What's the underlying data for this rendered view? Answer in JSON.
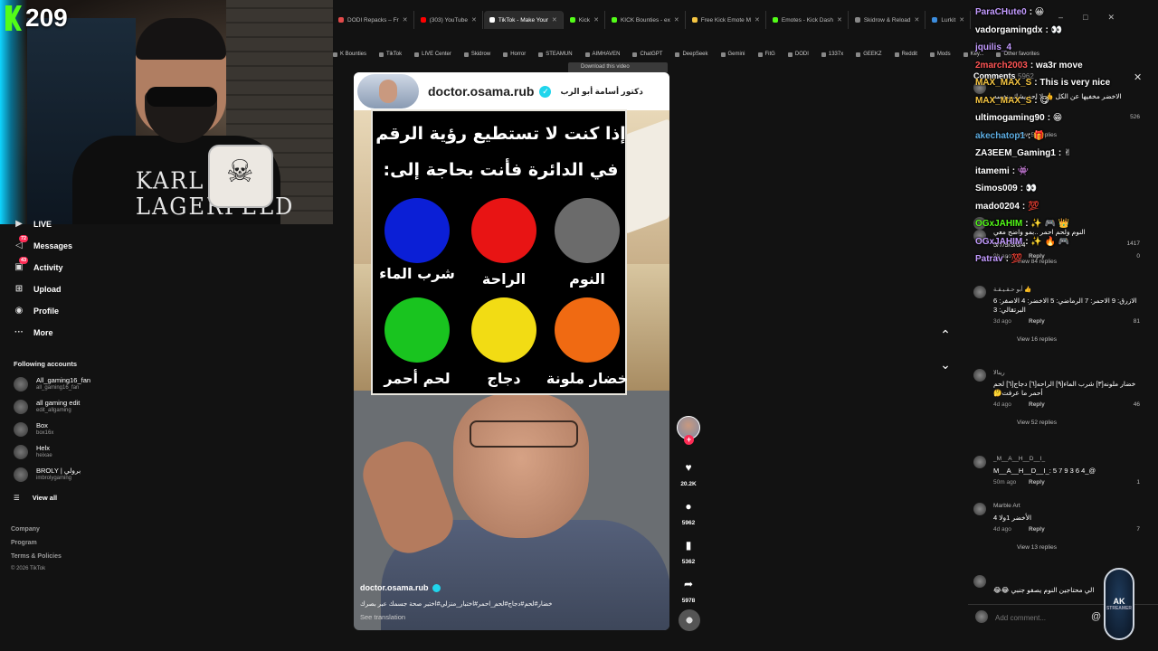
{
  "stream": {
    "viewer_count": "209",
    "cam_text": "KARL\nLAGERFELD"
  },
  "tabs": [
    {
      "label": "DODI Repacks – Fr",
      "color": "#e24a4a",
      "active": false
    },
    {
      "label": "(303) YouTube",
      "color": "#ff0000",
      "active": false
    },
    {
      "label": "TikTok - Make Your",
      "color": "#ffffff",
      "active": true
    },
    {
      "label": "Kick",
      "color": "#53fc18",
      "active": false
    },
    {
      "label": "KICK Bounties - ex",
      "color": "#53fc18",
      "active": false
    },
    {
      "label": "Free Kick Emote M",
      "color": "#f5c542",
      "active": false
    },
    {
      "label": "Emotes - Kick Dash",
      "color": "#53fc18",
      "active": false
    },
    {
      "label": "Skidrow & Reload",
      "color": "#888888",
      "active": false
    },
    {
      "label": "Lurkit",
      "color": "#3c8dde",
      "active": false
    }
  ],
  "window_controls": [
    "–",
    "□",
    "✕"
  ],
  "bookmarks": [
    "K Bounties",
    "TikTok",
    "LIVE Center",
    "Skidrow",
    "Horror",
    "STEAMUN",
    "AIMHAVEN",
    "ChatGPT",
    "DeepSeek",
    "Gemini",
    "FitG",
    "DODI",
    "1337x",
    "GEEKZ",
    "Reddit",
    "Mods",
    "Key...",
    "Other favorites"
  ],
  "download_tip": "Download this video",
  "sidebar": {
    "nav": [
      {
        "label": "LIVE",
        "icon": "live-icon",
        "glyph": "▶",
        "badge": ""
      },
      {
        "label": "Messages",
        "icon": "messages-icon",
        "glyph": "◁",
        "badge": "72"
      },
      {
        "label": "Activity",
        "icon": "activity-icon",
        "glyph": "▣",
        "badge": "43"
      },
      {
        "label": "Upload",
        "icon": "upload-icon",
        "glyph": "⊞",
        "badge": ""
      },
      {
        "label": "Profile",
        "icon": "profile-icon",
        "glyph": "◉",
        "badge": ""
      },
      {
        "label": "More",
        "icon": "more-icon",
        "glyph": "···",
        "badge": ""
      }
    ],
    "following_title": "Following accounts",
    "accounts": [
      {
        "name": "All_gaming16_fan",
        "handle": "all_gaming16_fan"
      },
      {
        "name": "all gaming edit",
        "handle": "edit_allgaming"
      },
      {
        "name": "Box",
        "handle": "box16x"
      },
      {
        "name": "Helx",
        "handle": "heixae"
      },
      {
        "name": "BROLY | برولي",
        "handle": "imbrolygaming"
      }
    ],
    "view_all": "View all",
    "footer": [
      "Company",
      "Program",
      "Terms & Policies"
    ],
    "copyright": "© 2026 TikTok"
  },
  "video": {
    "username": "doctor.osama.rub",
    "display_name_ar": "دكتور أسامة أبو الرب",
    "card_line1": "إذا كنت لا تستطيع رؤية الرقم",
    "card_line2": "في الدائرة فأنت بحاجة إلى:",
    "circles": [
      {
        "label": "شرب الماء",
        "color": "#0b1fd6"
      },
      {
        "label": "الراحة",
        "color": "#e81414"
      },
      {
        "label": "النوم",
        "color": "#6b6b6b"
      },
      {
        "label": "لحم أحمر",
        "color": "#19c41f"
      },
      {
        "label": "دجاج",
        "color": "#f2dc14"
      },
      {
        "label": "خضار ملونة",
        "color": "#f06a12"
      }
    ],
    "caption_user": "doctor.osama.rub",
    "caption_tags": "خضار#لحم#دجاج#لحم_احمر#اختبار_منزلي#اختبر صحة جسمك عبر بصرك",
    "see_translation": "See translation"
  },
  "actions": {
    "likes": "20.2K",
    "comments": "5962",
    "saves": "5362",
    "shares": "5978"
  },
  "comments": {
    "title": "Comments",
    "count": "5962",
    "items": [
      {
        "user": "",
        "text": "الاخضر مخفيها عن الكل 👍 لا احد يشك بنفسه",
        "date": "",
        "likes": "526",
        "replies": "View 54 replies"
      },
      {
        "user": "",
        "text": "النوم ولحم احمر ..بمو واضح معي",
        "date": "",
        "likes": "1417",
        "replies": "View 84 replies"
      },
      {
        "user": "",
        "text": "5/7/9/3/6/4",
        "date": "9h ago",
        "likes": "0",
        "replies": ""
      },
      {
        "user": "أبو حـقـيـقـة 👍",
        "text": "الازرق: 9 الاحمر: 7 الرماضي: 5 الاخضر: 4 الاصفر: 6 البرتقالي: 3",
        "date": "3d ago",
        "likes": "81",
        "replies": "View 16 replies"
      },
      {
        "user": "ريتالا",
        "text": "خضار ملونه[٣] شرب الماء[٩] الراحه[٦] دجاج[٦] لحم أحمر ما عرفت🤔",
        "date": "4d ago",
        "likes": "46",
        "replies": "View 52 replies"
      },
      {
        "user": "_M__A__H__D__I_",
        "text": "@_M__A__H__D__I_: 5 7 9 3 6 4",
        "date": "50m ago",
        "likes": "1",
        "replies": ""
      },
      {
        "user": "Marble Art",
        "text": "الأخضر 1ولا 4",
        "date": "4d ago",
        "likes": "7",
        "replies": "View 13 replies"
      },
      {
        "user": "",
        "text": "الي محتاجين النوم يصفو جنبي 😂😂",
        "date": "",
        "likes": "",
        "replies": ""
      }
    ],
    "reply_label": "Reply",
    "add_placeholder": "Add comment...",
    "at_glyph": "@"
  },
  "chat": [
    {
      "user": "ParaCHute0",
      "msg": ": 😀",
      "color": "#c39bff"
    },
    {
      "user": "vadorgamingdx",
      "msg": ": 👀",
      "color": "#ffffff"
    },
    {
      "user": "jquilis_4",
      "msg": "",
      "color": "#c39bff"
    },
    {
      "user": "2march2003",
      "msg": ": wa3r move",
      "color": "#ff5555"
    },
    {
      "user": "MAX_MAX_S",
      "msg": ": This is very nice",
      "color": "#f5c542"
    },
    {
      "user": "MAX_MAX_S",
      "msg": ": 😋",
      "color": "#f5c542"
    },
    {
      "user": "ultimogaming90",
      "msg": ": 😁",
      "color": "#ffffff"
    },
    {
      "user": "akechatop1",
      "msg": ": 🎁",
      "color": "#5dade2"
    },
    {
      "user": "ZA3EEM_Gaming1",
      "msg": ": ✌",
      "color": "#ffffff"
    },
    {
      "user": "itamemi",
      "msg": ": 👾",
      "color": "#ffffff"
    },
    {
      "user": "Simos009",
      "msg": ": 👀",
      "color": "#ffffff"
    },
    {
      "user": "mado0204",
      "msg": ": 💯",
      "color": "#ffffff"
    },
    {
      "user": "OGxJAHIM",
      "msg": ": ✨ 🎮 👑",
      "color": "#53fc18"
    },
    {
      "user": "OGxJAHIM",
      "msg": ": ✨ 🔥 🎮",
      "color": "#c39bff"
    },
    {
      "user": "Patrav",
      "msg": ": 💯",
      "color": "#c39bff"
    }
  ],
  "logo": {
    "text": "AK",
    "sub": "STREAMER"
  },
  "colors": {
    "accent": "#fe2c55",
    "kick": "#53fc18",
    "verified": "#20d5ec"
  }
}
